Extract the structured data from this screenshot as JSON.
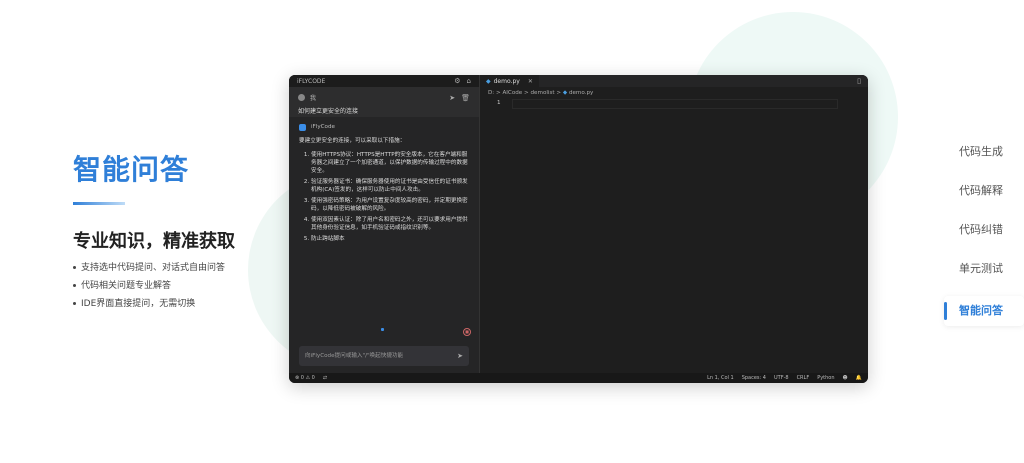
{
  "left": {
    "title": "智能问答",
    "subtitle": "专业知识，精准获取",
    "bullets": [
      "支持选中代码提问、对话式自由问答",
      "代码相关问题专业解答",
      "IDE界面直接提问，无需切换"
    ]
  },
  "nav": {
    "items": [
      "代码生成",
      "代码解释",
      "代码纠错",
      "单元测试",
      "智能问答"
    ],
    "active": "智能问答"
  },
  "ide": {
    "panel_title": "iFLYCODE",
    "user": {
      "name": "我",
      "message": "如何建立更安全的连接"
    },
    "bot": {
      "name": "iFlyCode",
      "intro": "要建立更安全的连接，可以采取以下措施：",
      "points": [
        "使用HTTPS协议：HTTPS是HTTP的安全版本，它在客户端和服务器之间建立了一个加密通道，以保护数据的传输过程中的数据安全。",
        "验证服务器证书：确保服务器使用的证书是由受信任的证书颁发机构(CA)签发的，这样可以防止中间人攻击。",
        "使用强密码策略：为用户设置复杂度较高的密码，并定期更换密码，以降低密码被破解的风险。",
        "使用双因素认证：除了用户名和密码之外，还可以要求用户提供其他身份验证信息，如手机验证码或指纹识别等。",
        "防止跨站脚本"
      ]
    },
    "input_placeholder": "向iFlyCode提问或输入\"/\"唤起快捷功能",
    "tab_label": "demo.py",
    "breadcrumb": [
      "D:",
      "AICode",
      "demolist",
      "demo.py"
    ],
    "line_number": "1",
    "status": {
      "errors": "0",
      "warnings": "0",
      "ln_col": "Ln 1, Col 1",
      "spaces": "Spaces: 4",
      "encoding": "UTF-8",
      "eol": "CRLF",
      "language": "Python"
    }
  }
}
